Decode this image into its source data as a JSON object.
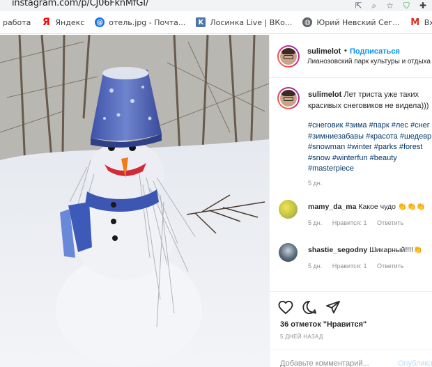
{
  "browser": {
    "url": "instagram.com/p/CJ06FknMfGI/",
    "bookmarks": [
      {
        "label": "работа",
        "icon": "folder-icon",
        "color": "#f4b400"
      },
      {
        "label": "Яндекс",
        "icon": "yandex-icon",
        "color": "#ff0000"
      },
      {
        "label": "отель.jpg - Почта...",
        "icon": "mail-at-icon",
        "color": "#1a73e8"
      },
      {
        "label": "Лосинка Live | ВКо...",
        "icon": "vk-icon",
        "color": "#4a76a8"
      },
      {
        "label": "Юрий Невский Сег...",
        "icon": "globe-icon",
        "color": "#5f6368"
      },
      {
        "label": "Входящие",
        "icon": "gmail-icon",
        "color": "#d93025"
      }
    ]
  },
  "post": {
    "username": "sulimelot",
    "dot": "•",
    "follow_label": "Подписаться",
    "location": "Лианозовский парк культуры и отдыха",
    "caption_user": "sulimelot",
    "caption_text": "Лет триста уже таких красивых снеговиков не видела)))",
    "hashtags_lines": [
      "#снеговик #зима #парк #лес #снег",
      "#зимниезабавы #красота #шедевр",
      "#snowman #winter #parks #forest",
      "#snow #winterfun #beauty",
      "#masterpiece"
    ],
    "caption_time": "5 дн.",
    "comments": [
      {
        "user": "mamy_da_ma",
        "text": "Какое чудо 👏👏👏",
        "time": "5 дн.",
        "likes": "Нравится: 1",
        "reply": "Ответить",
        "avatar_color": "#d7d84a"
      },
      {
        "user": "shastie_segodny",
        "text": "Шикарный!!!!👏",
        "time": "5 дн.",
        "likes": "Нравится: 1",
        "reply": "Ответить",
        "avatar_color": "#4a5a6a"
      }
    ],
    "likes_label": "36 отметок \"Нравится\"",
    "ago_label": "5 ДНЕЙ НАЗАД",
    "add_comment_placeholder": "Добавьте комментарий...",
    "publish_label": "Опубликовать"
  }
}
